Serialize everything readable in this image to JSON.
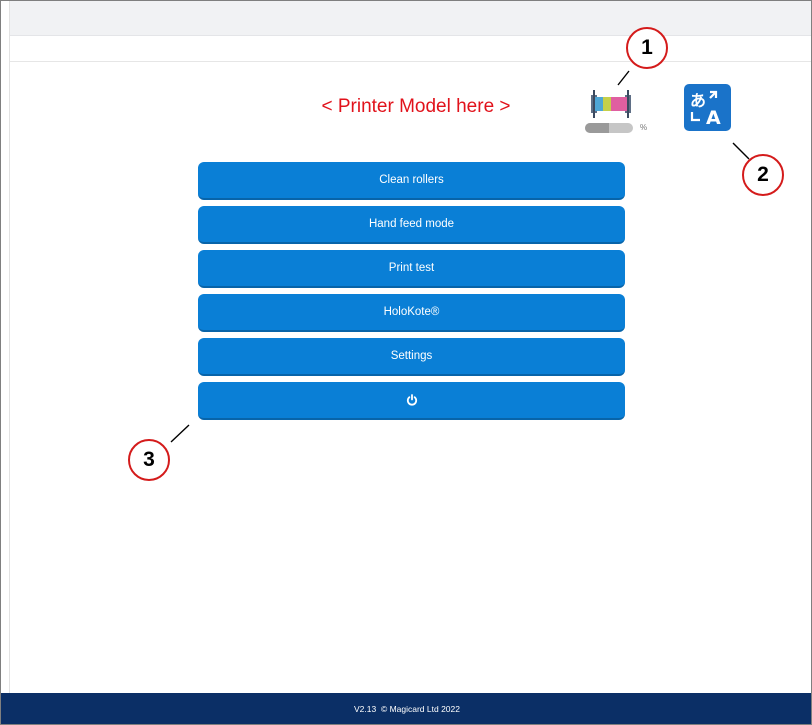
{
  "header": {
    "printer_model": "< Printer Model here >",
    "ribbon_level_unit": "%",
    "ribbon_level": 0.5
  },
  "menu": {
    "items": [
      {
        "label": "Clean rollers"
      },
      {
        "label": "Hand feed mode"
      },
      {
        "label": "Print test"
      },
      {
        "label": "HoloKote®"
      },
      {
        "label": "Settings"
      }
    ],
    "power_icon": "power-icon"
  },
  "callouts": [
    "1",
    "2",
    "3"
  ],
  "footer": {
    "version": "V2.13",
    "copyright": "© Magicard Ltd 2022"
  },
  "colors": {
    "accent": "#0a7fd6",
    "footer": "#0b2f66",
    "model_text": "#e1121b",
    "callout_border": "#d41b1b"
  }
}
